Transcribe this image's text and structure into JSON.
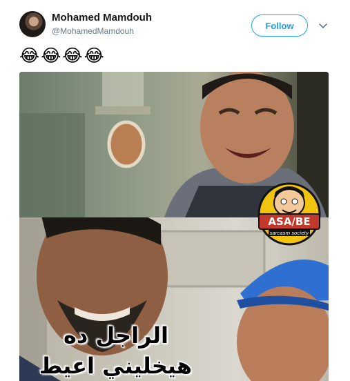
{
  "tweet": {
    "author": {
      "display_name": "Mohamed Mamdouh",
      "handle": "@MohamedMamdouh"
    },
    "follow_label": "Follow",
    "text": "😂😂😂😂",
    "media": {
      "caption_lines": [
        "الراجل ده",
        "هيخليني اعيط"
      ],
      "logo": {
        "brand": "ASA/BE",
        "tagline": "sarcasm society"
      }
    }
  },
  "colors": {
    "accent": "#1da1f2",
    "name": "#14171a",
    "secondary": "#657786"
  },
  "icons": {
    "menu": "chevron-down-icon"
  }
}
